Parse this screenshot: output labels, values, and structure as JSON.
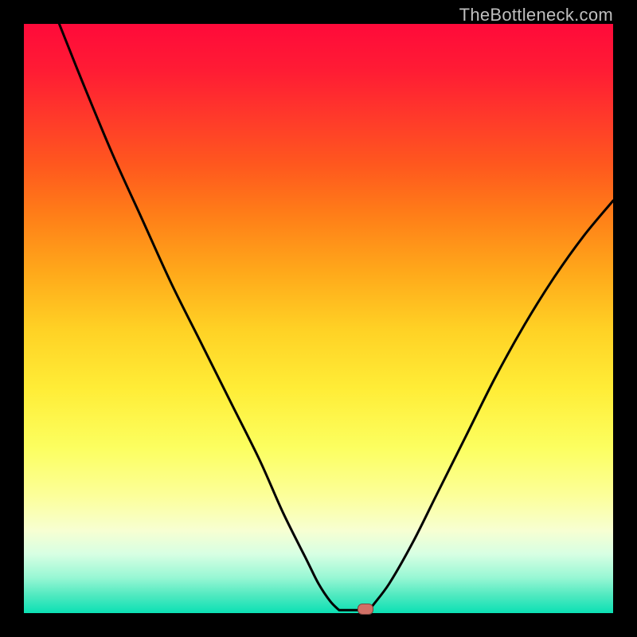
{
  "attribution": "TheBottleneck.com",
  "colors": {
    "curve_stroke": "#000000",
    "marker_fill": "#d17066",
    "frame_bg": "#000000"
  },
  "chart_data": {
    "type": "line",
    "title": "",
    "xlabel": "",
    "ylabel": "",
    "xlim": [
      0,
      100
    ],
    "ylim": [
      0,
      100
    ],
    "series": [
      {
        "name": "left-falling-curve",
        "x": [
          6,
          10,
          15,
          20,
          25,
          30,
          35,
          40,
          44,
          48,
          50,
          52,
          53.5
        ],
        "values": [
          100,
          90,
          78,
          67,
          56,
          46,
          36,
          26,
          17,
          9,
          5,
          2,
          0.5
        ]
      },
      {
        "name": "right-rising-curve",
        "x": [
          59,
          62,
          66,
          70,
          75,
          80,
          85,
          90,
          95,
          100
        ],
        "values": [
          1,
          5,
          12,
          20,
          30,
          40,
          49,
          57,
          64,
          70
        ]
      }
    ],
    "annotations": [
      {
        "name": "floor-segment",
        "x_start": 53.5,
        "x_end": 59,
        "y": 0.5
      },
      {
        "name": "marker",
        "x": 58,
        "y": 0.7
      }
    ]
  }
}
